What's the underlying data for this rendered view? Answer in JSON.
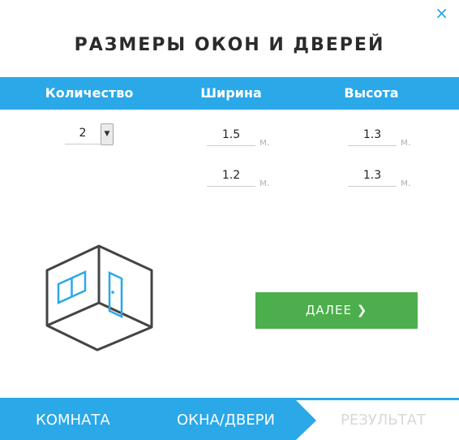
{
  "close_symbol": "×",
  "title": "РАЗМЕРЫ ОКОН И ДВЕРЕЙ",
  "table": {
    "headers": [
      "Количество",
      "Ширина",
      "Высота"
    ],
    "quantity_selected": "2",
    "rows": [
      {
        "width": "1.5",
        "height": "1.3"
      },
      {
        "width": "1.2",
        "height": "1.3"
      }
    ],
    "unit": "м."
  },
  "next_button": {
    "label": "ДАЛЕЕ",
    "icon": "chevron-right-icon"
  },
  "steps": [
    "КОМНАТА",
    "ОКНА/ДВЕРИ",
    "РЕЗУЛЬТАТ"
  ],
  "colors": {
    "accent_blue": "#2aa8e8",
    "button_green": "#4cae4c",
    "inactive_step": "#d8d8d8"
  }
}
